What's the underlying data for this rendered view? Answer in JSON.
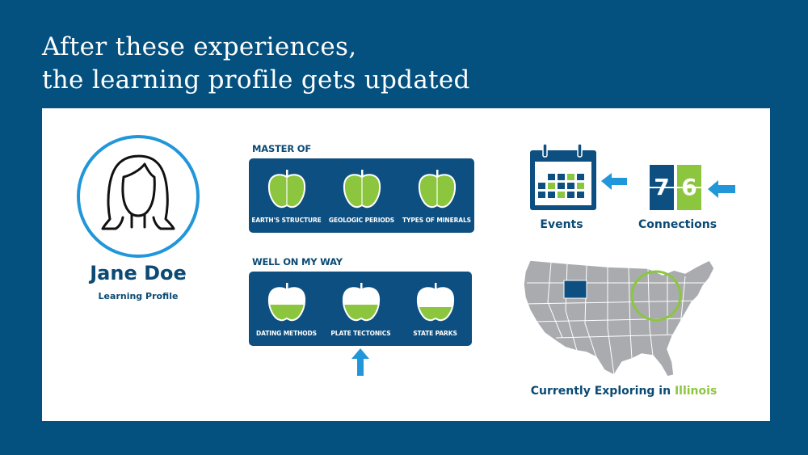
{
  "heading": {
    "line1": "After these experiences,",
    "line2": "the learning profile gets updated"
  },
  "profile": {
    "name": "Jane Doe",
    "subtitle": "Learning Profile",
    "avatar_icon": "girl-portrait-icon"
  },
  "mastered": {
    "label": "MASTER OF",
    "items": [
      {
        "label": "EARTH'S STRUCTURE",
        "fill": 1.0
      },
      {
        "label": "GEOLOGIC PERIODS",
        "fill": 1.0
      },
      {
        "label": "TYPES OF MINERALS",
        "fill": 1.0
      }
    ]
  },
  "progress": {
    "label": "WELL ON MY WAY",
    "items": [
      {
        "label": "DATING METHODS",
        "fill": 0.4
      },
      {
        "label": "PLATE TECTONICS",
        "fill": 0.4
      },
      {
        "label": "STATE PARKS",
        "fill": 0.3
      }
    ],
    "arrow_icon": "up-arrow-icon"
  },
  "events": {
    "label": "Events",
    "icon": "calendar-icon"
  },
  "connections": {
    "label": "Connections",
    "digits": [
      "7",
      "6"
    ]
  },
  "map": {
    "icon": "us-map-icon",
    "prefix": "Currently Exploring in",
    "state": "Illinois"
  },
  "colors": {
    "navy": "#04507f",
    "panel": "#0d4f80",
    "green": "#8cc63f",
    "blue_accent": "#2196d8"
  }
}
